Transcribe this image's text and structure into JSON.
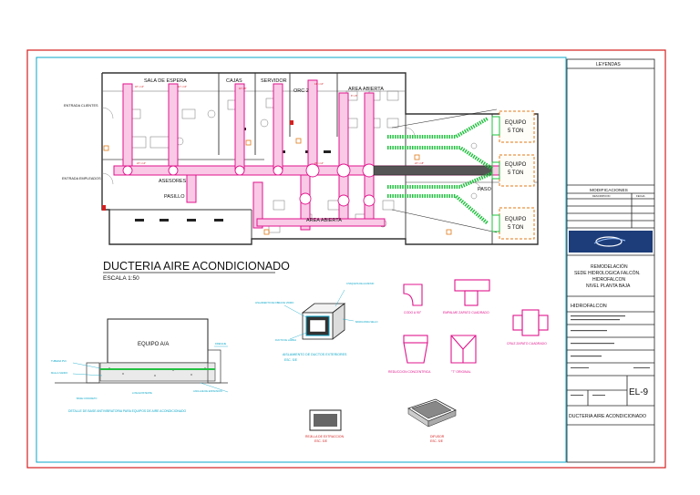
{
  "drawing": {
    "title": "DUCTERIA AIRE ACONDICIONADO",
    "scale": "ESCALA 1:50"
  },
  "rooms": {
    "sala_espera": "SALA DE ESPERA",
    "cajas": "CAJAS",
    "servidor": "SERVIDOR",
    "area_abierta_top": "AREA ABIERTA",
    "orc": "ORC 2",
    "asesores": "ASESORES",
    "pasillo": "PASILLO",
    "area_abierta_bottom": "AREA ABIERTA",
    "paso": "PASO",
    "entrada_clientes": "ENTRADA CLIENTES",
    "entrada_empleados": "ENTRADA EMPLEADOS"
  },
  "equipment": {
    "equipo_1": "EQUIPO",
    "equipo_1_cap": "5 TON",
    "equipo_2": "EQUIPO",
    "equipo_2_cap": "5 TON",
    "equipo_3": "EQUIPO",
    "equipo_3_cap": "5 TON"
  },
  "details": {
    "equipo_aa": "EQUIPO A/A",
    "detalle_base": "DETALLE DE BASE ANTIVIBRATORIA PARA EQUIPOS DE AIRE ACONDICIONADO",
    "aislamiento": "AISLAMIENTO DE DUCTOS EXTERIORES",
    "aislamiento_esc": "ESC. S/E",
    "codo": "CODO A 90°",
    "empalme": "EMPALME ZAPATO CUADRADO",
    "reduccion": "REDUCCION CONCENTRICA",
    "t_original": "\"T\" ORIGINAL",
    "cruz": "CRUZ ZAPATO CUADRADO",
    "rejilla": "REJILLA DE EXTRACCION",
    "rejilla_esc": "ESC. S/E",
    "difusor": "DIFUSOR",
    "difusor_esc": "ESC. S/E"
  },
  "title_block": {
    "leyendas": "LEYENDAS",
    "modificaciones": "MODIFICACIONES",
    "col_descripcion": "DESCRIPCION",
    "col_fecha": "FECHA",
    "project_line1": "REMODELACIÓN",
    "project_line2": "SEDE HIDROLOGICA FALCÓN.",
    "project_line3": "HIDROFALCON",
    "project_line4": "NIVEL PLANTA BAJA",
    "client": "HIDROFALCON",
    "sheet_code": "EL-9",
    "sheet_title": "DUCTERIA AIRE ACONDICIONADO"
  },
  "colors": {
    "frame": "#d42020",
    "inner_border": "#0aa6c8",
    "duct": "#e0148c",
    "equipment_outline": "#e07a1a",
    "green_duct": "#22c040"
  }
}
